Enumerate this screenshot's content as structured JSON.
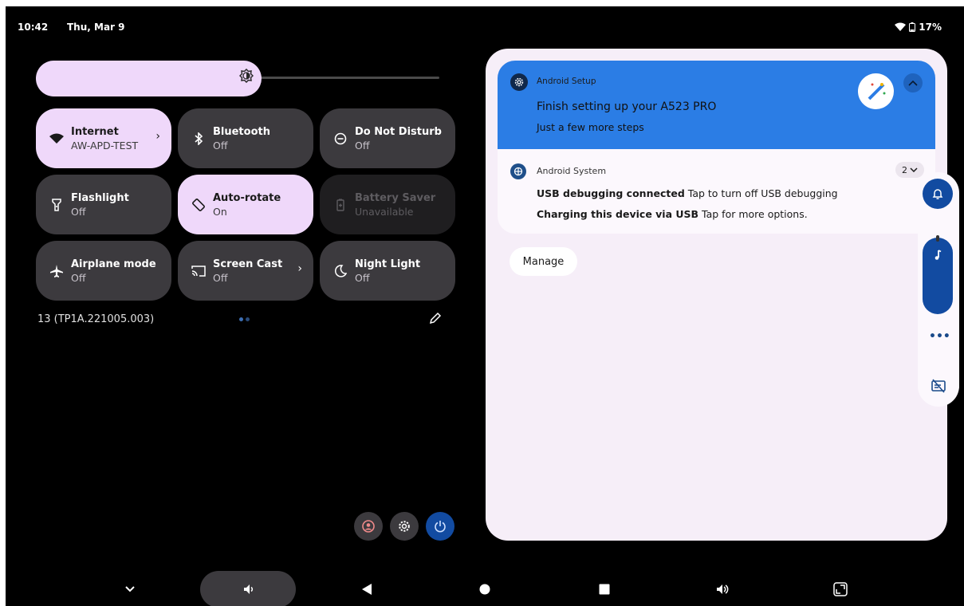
{
  "status_bar": {
    "time": "10:42",
    "date": "Thu, Mar 9",
    "battery": "17%"
  },
  "brightness": {
    "level": 0.56
  },
  "tiles": [
    {
      "title": "Internet",
      "subtitle": "AW-APD-TEST",
      "icon": "wifi-icon",
      "state": "on",
      "has_chevron": true
    },
    {
      "title": "Bluetooth",
      "subtitle": "Off",
      "icon": "bluetooth-icon",
      "state": "off"
    },
    {
      "title": "Do Not Disturb",
      "subtitle": "Off",
      "icon": "dnd-icon",
      "state": "off"
    },
    {
      "title": "Flashlight",
      "subtitle": "Off",
      "icon": "flashlight-icon",
      "state": "off"
    },
    {
      "title": "Auto-rotate",
      "subtitle": "On",
      "icon": "rotate-icon",
      "state": "on"
    },
    {
      "title": "Battery Saver",
      "subtitle": "Unavailable",
      "icon": "battery-saver-icon",
      "state": "unavailable"
    },
    {
      "title": "Airplane mode",
      "subtitle": "Off",
      "icon": "airplane-icon",
      "state": "off"
    },
    {
      "title": "Screen Cast",
      "subtitle": "Off",
      "icon": "cast-icon",
      "state": "off",
      "has_chevron": true
    },
    {
      "title": "Night Light",
      "subtitle": "Off",
      "icon": "moon-icon",
      "state": "off"
    }
  ],
  "build_number": "13 (TP1A.221005.003)",
  "notifications": {
    "setup": {
      "app": "Android Setup",
      "title": "Finish setting up your A523 PRO",
      "text": "Just a few more steps"
    },
    "system": {
      "app": "Android System",
      "count": "2",
      "lines": [
        {
          "bold": "USB debugging connected",
          "text": "Tap to turn off USB debugging"
        },
        {
          "bold": "Charging this device via USB",
          "text": "Tap for more options."
        }
      ]
    },
    "manage_label": "Manage"
  },
  "colors": {
    "tile_on": "#efd8fa",
    "tile_off": "#3c3a3e",
    "setup_notif": "#2b7de5",
    "panel": "#f6eef8",
    "accent_blue": "#124ba1"
  },
  "side_panel": {
    "more_label": "•••"
  }
}
